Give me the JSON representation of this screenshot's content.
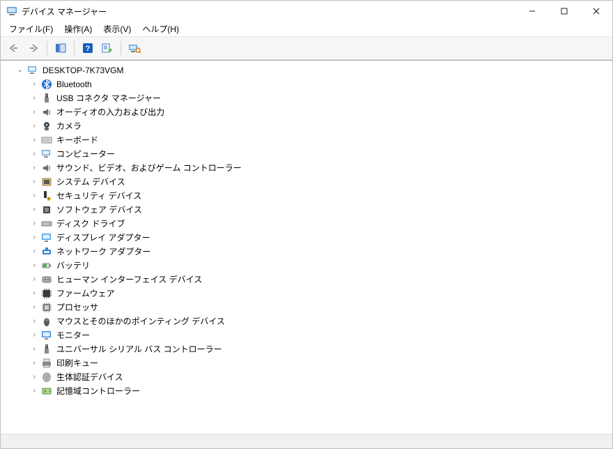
{
  "window": {
    "title": "デバイス マネージャー"
  },
  "menu": {
    "file": "ファイル(F)",
    "action": "操作(A)",
    "view": "表示(V)",
    "help": "ヘルプ(H)"
  },
  "toolbar": {
    "back_icon": "back-arrow-icon",
    "forward_icon": "forward-arrow-icon",
    "show_hide_icon": "console-tree-icon",
    "help_icon": "help-icon",
    "properties_icon": "properties-icon",
    "scan_hw_icon": "scan-hardware-icon"
  },
  "tree": {
    "root": {
      "label": "DESKTOP-7K73VGM",
      "icon": "computer-icon",
      "expanded": true
    },
    "items": [
      {
        "label": "Bluetooth",
        "icon": "bluetooth-icon"
      },
      {
        "label": "USB コネクタ マネージャー",
        "icon": "usb-connector-icon"
      },
      {
        "label": "オーディオの入力および出力",
        "icon": "audio-io-icon"
      },
      {
        "label": "カメラ",
        "icon": "camera-icon"
      },
      {
        "label": "キーボード",
        "icon": "keyboard-icon"
      },
      {
        "label": "コンピューター",
        "icon": "computer-icon"
      },
      {
        "label": "サウンド、ビデオ、およびゲーム コントローラー",
        "icon": "sound-video-game-icon"
      },
      {
        "label": "システム デバイス",
        "icon": "system-devices-icon"
      },
      {
        "label": "セキュリティ デバイス",
        "icon": "security-device-icon"
      },
      {
        "label": "ソフトウェア デバイス",
        "icon": "software-device-icon"
      },
      {
        "label": "ディスク ドライブ",
        "icon": "disk-drive-icon"
      },
      {
        "label": "ディスプレイ アダプター",
        "icon": "display-adapter-icon"
      },
      {
        "label": "ネットワーク アダプター",
        "icon": "network-adapter-icon"
      },
      {
        "label": "バッテリ",
        "icon": "battery-icon"
      },
      {
        "label": "ヒューマン インターフェイス デバイス",
        "icon": "hid-icon"
      },
      {
        "label": "ファームウェア",
        "icon": "firmware-icon"
      },
      {
        "label": "プロセッサ",
        "icon": "processor-icon"
      },
      {
        "label": "マウスとそのほかのポインティング デバイス",
        "icon": "mouse-icon"
      },
      {
        "label": "モニター",
        "icon": "monitor-icon"
      },
      {
        "label": "ユニバーサル シリアル バス コントローラー",
        "icon": "usb-controller-icon"
      },
      {
        "label": "印刷キュー",
        "icon": "print-queue-icon"
      },
      {
        "label": "生体認証デバイス",
        "icon": "biometric-icon"
      },
      {
        "label": "記憶域コントローラー",
        "icon": "storage-controller-icon"
      }
    ]
  }
}
